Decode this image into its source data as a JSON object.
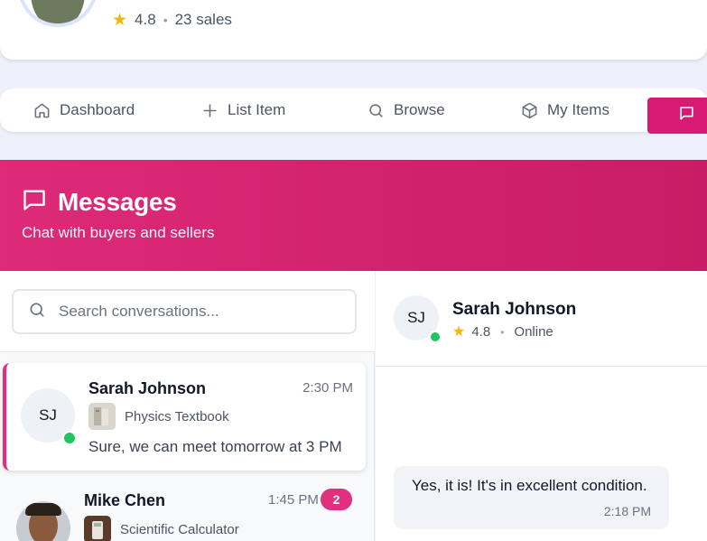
{
  "profile": {
    "rating": "4.8",
    "separator": "•",
    "sales": "23 sales"
  },
  "nav": {
    "items": [
      {
        "label": "Dashboard",
        "icon": "home-icon"
      },
      {
        "label": "List Item",
        "icon": "plus-icon"
      },
      {
        "label": "Browse",
        "icon": "search-icon"
      },
      {
        "label": "My Items",
        "icon": "package-icon"
      }
    ],
    "active_icon": "message-square-icon"
  },
  "header": {
    "title": "Messages",
    "subtitle": "Chat with buyers and sellers"
  },
  "search": {
    "placeholder": "Search conversations..."
  },
  "conversations": [
    {
      "initials": "SJ",
      "name": "Sarah Johnson",
      "time": "2:30 PM",
      "item": "Physics Textbook",
      "last_message": "Sure, we can meet tomorrow at 3 PM",
      "online": true
    },
    {
      "name": "Mike Chen",
      "time": "1:45 PM",
      "unread": "2",
      "item": "Scientific Calculator"
    }
  ],
  "chat": {
    "initials": "SJ",
    "name": "Sarah Johnson",
    "rating": "4.8",
    "separator": "•",
    "status": "Online",
    "messages": [
      {
        "text": "Yes, it is! It's in excellent condition.",
        "time": "2:18 PM"
      }
    ]
  },
  "colors": {
    "accent": "#d81b72",
    "online": "#22c55e",
    "star": "#f5b50a"
  }
}
